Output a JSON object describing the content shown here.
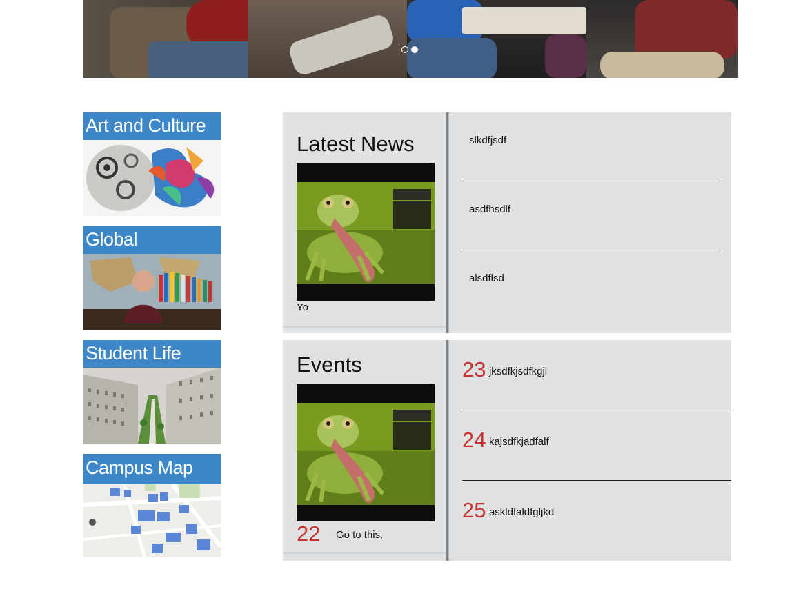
{
  "hero": {
    "slide_count": 2,
    "active_slide": 2
  },
  "tiles": [
    {
      "label": "Art and Culture"
    },
    {
      "label": "Global"
    },
    {
      "label": "Student Life"
    },
    {
      "label": "Campus Map"
    }
  ],
  "news": {
    "heading": "Latest News",
    "caption": "Yo",
    "items": [
      "slkdfjsdf",
      "asdfhsdlf",
      "alsdflsd"
    ]
  },
  "events": {
    "heading": "Events",
    "featured": {
      "day": "22",
      "text": "Go to this."
    },
    "items": [
      {
        "day": "23",
        "text": "jksdfkjsdfkgjl"
      },
      {
        "day": "24",
        "text": "kajsdfkjadfalf"
      },
      {
        "day": "25",
        "text": "askldfaldfgljkd"
      }
    ]
  },
  "colors": {
    "tile_label": "#3d87c9",
    "panel_bg": "#dfe1e3",
    "date_accent": "#c8342f"
  },
  "icons": [
    "frog-thumbnail-image"
  ]
}
